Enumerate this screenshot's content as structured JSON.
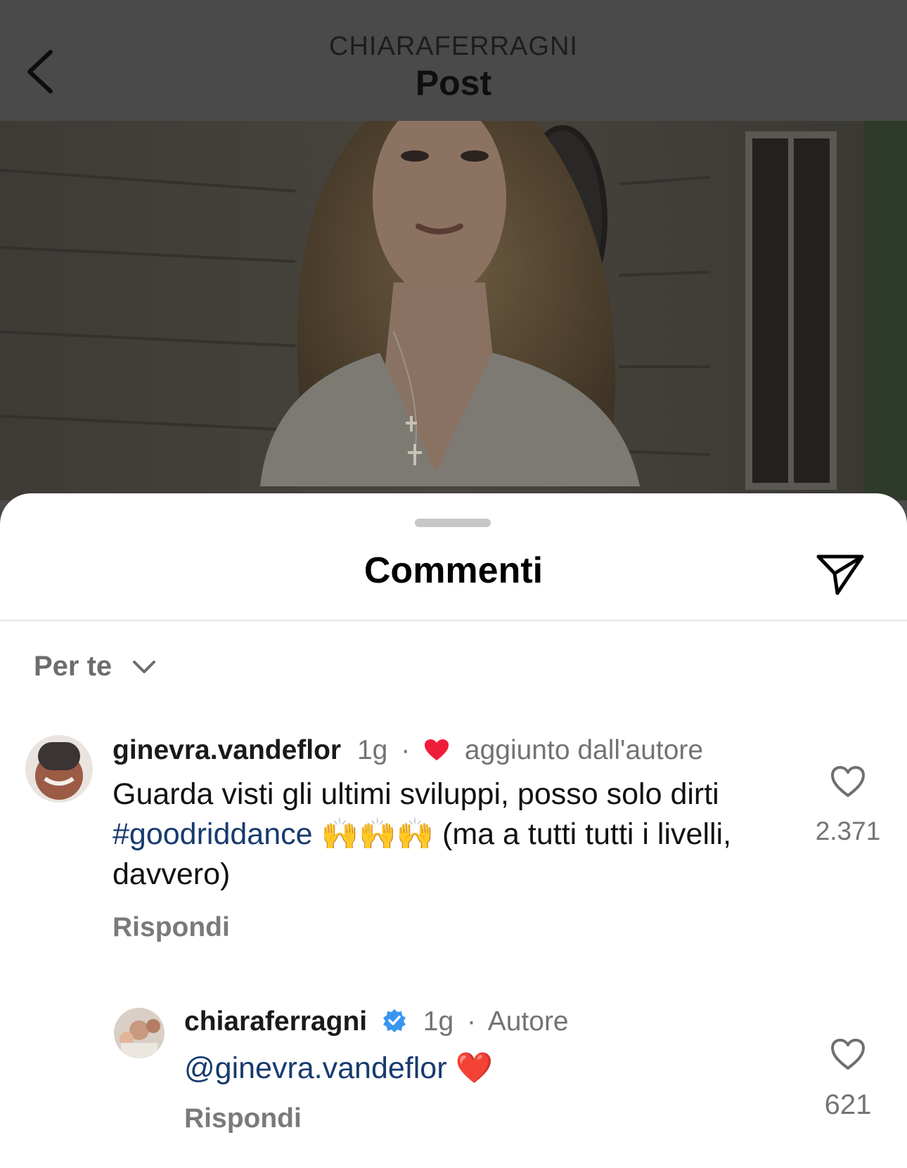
{
  "header": {
    "account": "CHIARAFERRAGNI",
    "title": "Post",
    "back_icon": "chevron-left-icon"
  },
  "sheet": {
    "title": "Commenti",
    "share_icon": "paper-plane-icon",
    "sort": {
      "label": "Per te",
      "icon": "chevron-down-icon"
    }
  },
  "comments": [
    {
      "username": "ginevra.vandeflor",
      "time": "1g",
      "separator": "·",
      "badge": "aggiunto dall'autore",
      "badge_icon": "heart-filled-icon",
      "text_before": "Guarda visti gli ultimi sviluppi, posso solo dirti",
      "hashtag": "#goodriddance",
      "text_after": "🙌🙌🙌 (ma a tutti tutti i livelli, davvero)",
      "reply_label": "Rispondi",
      "like_count": "2.371"
    },
    {
      "username": "chiaraferragni",
      "verified_icon": "verified-badge-icon",
      "time": "1g",
      "separator": "·",
      "role": "Autore",
      "mention": "@ginevra.vandeflor",
      "text_after": "❤️",
      "reply_label": "Rispondi",
      "like_count": "621"
    }
  ],
  "colors": {
    "overlay": "#4a4a4a",
    "link": "#173a6e",
    "heart_red": "#ef1c3a",
    "verified_blue": "#3797f0"
  }
}
